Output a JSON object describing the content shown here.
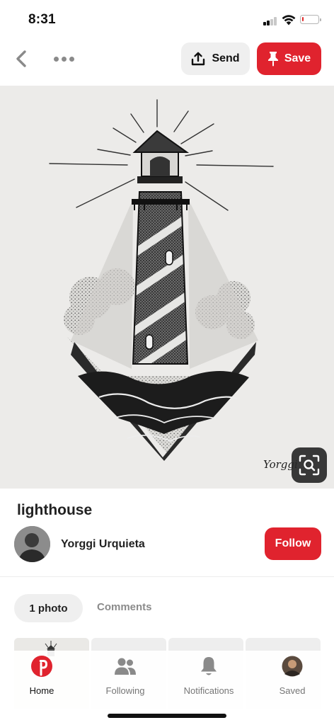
{
  "status_bar": {
    "time": "8:31",
    "signal_bars_filled": 2,
    "signal_bars_total": 4,
    "battery_level": 0.12,
    "battery_color": "#e02a2a"
  },
  "top_nav": {
    "back_icon": "chevron-left-icon",
    "more_icon": "more-horizontal-icon",
    "send_label": "Send",
    "send_icon": "share-upload-icon",
    "save_label": "Save",
    "save_icon": "pushpin-icon"
  },
  "pin": {
    "image_description_icon": "lighthouse-artwork",
    "signature": "Yorggi",
    "visual_search_icon": "visual-search-icon",
    "title": "lighthouse"
  },
  "creator": {
    "name": "Yorggi Urquieta",
    "follow_label": "Follow"
  },
  "tabs": {
    "photos_label": "1 photo",
    "comments_label": "Comments"
  },
  "bottom_nav": {
    "items": [
      {
        "label": "Home",
        "icon": "pinterest-logo-icon",
        "active": true
      },
      {
        "label": "Following",
        "icon": "people-icon",
        "active": false
      },
      {
        "label": "Notifications",
        "icon": "bell-icon",
        "active": false
      },
      {
        "label": "Saved",
        "icon": "profile-avatar-icon",
        "active": false
      }
    ]
  },
  "colors": {
    "brand_red": "#e0232e",
    "pill_gray": "#efefef",
    "muted_text": "#8b8b8b"
  }
}
